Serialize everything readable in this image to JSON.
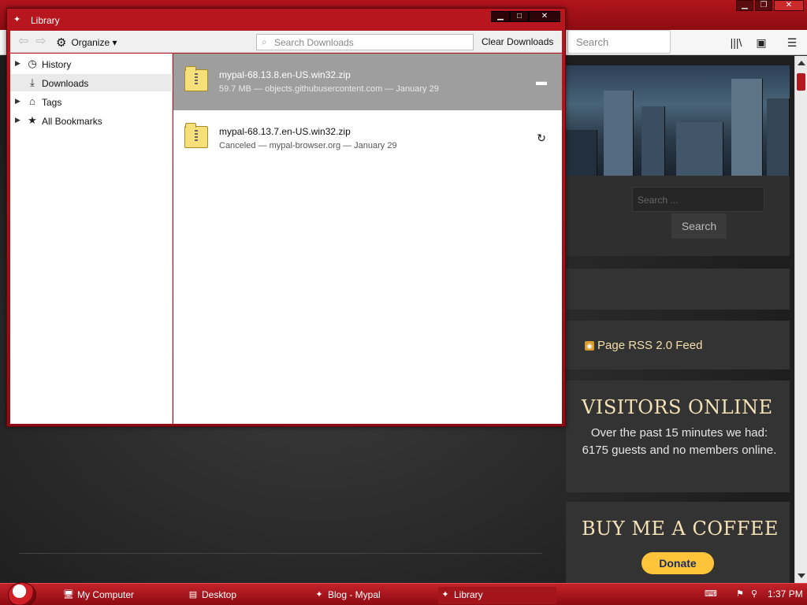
{
  "browser": {
    "search_placeholder": "Search",
    "sidebar": {
      "search_input_placeholder": "Search ...",
      "search_button": "Search",
      "rss_label": "Page RSS 2.0 Feed",
      "visitors_title": "VISITORS ONLINE",
      "visitors_text": "Over the past 15 minutes we had: 6175 guests and no members online.",
      "coffee_title": "BUY ME A COFFEE",
      "donate_label": "Donate"
    }
  },
  "library": {
    "title": "Library",
    "toolbar": {
      "organize_label": "Organize",
      "search_placeholder": "Search Downloads",
      "clear_label": "Clear Downloads"
    },
    "tree": [
      {
        "label": "History",
        "icon": "clock-icon",
        "has_twisty": true
      },
      {
        "label": "Downloads",
        "icon": "download-arrow-icon",
        "has_twisty": false,
        "selected": true
      },
      {
        "label": "Tags",
        "icon": "tag-icon",
        "has_twisty": true
      },
      {
        "label": "All Bookmarks",
        "icon": "star-icon",
        "has_twisty": true
      }
    ],
    "downloads": [
      {
        "name": "mypal-68.13.8.en-US.win32.zip",
        "status": "59.7 MB — objects.githubusercontent.com — January 29",
        "action_icon": "folder-icon",
        "selected": true
      },
      {
        "name": "mypal-68.13.7.en-US.win32.zip",
        "status": "Canceled — mypal-browser.org — January 29",
        "action_icon": "retry-icon",
        "selected": false
      }
    ]
  },
  "taskbar": {
    "items": [
      {
        "label": "My Computer",
        "icon": "computer-icon"
      },
      {
        "label": "Desktop",
        "icon": "desktop-icon"
      },
      {
        "label": "Blog - Mypal",
        "icon": "mypal-icon"
      },
      {
        "label": "Library",
        "icon": "mypal-icon",
        "active": true
      }
    ],
    "clock": "1:37 PM"
  },
  "colors": {
    "accent": "#b3141c",
    "selected_row": "#9e9e9e",
    "sidebar_heading": "#f5e2b4"
  }
}
